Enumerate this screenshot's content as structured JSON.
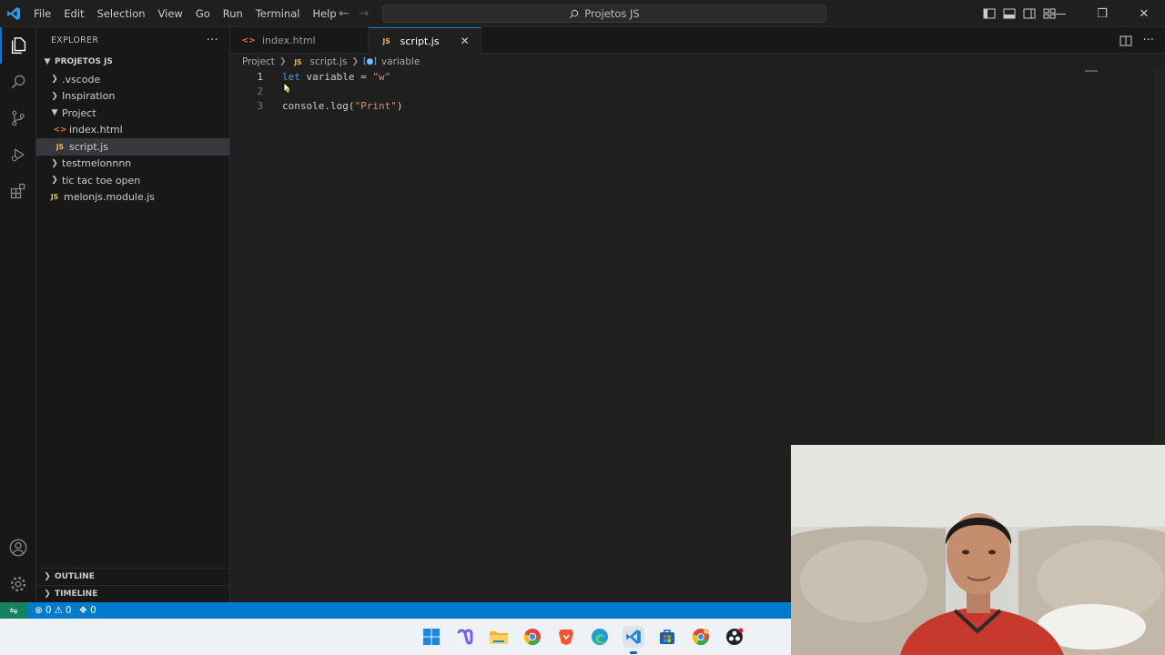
{
  "titlebar": {
    "menu": [
      "File",
      "Edit",
      "Selection",
      "View",
      "Go",
      "Run",
      "Terminal",
      "Help"
    ],
    "search": "Projetos JS"
  },
  "explorer": {
    "header": "EXPLORER",
    "workspace": "PROJETOS JS",
    "items": [
      {
        "label": ".vscode",
        "type": "folder"
      },
      {
        "label": "Inspiration",
        "type": "folder"
      },
      {
        "label": "Project",
        "type": "folder-open"
      },
      {
        "label": "index.html",
        "type": "html"
      },
      {
        "label": "script.js",
        "type": "js"
      },
      {
        "label": "testmelonnnn",
        "type": "folder"
      },
      {
        "label": "tic tac toe open",
        "type": "folder"
      },
      {
        "label": "melonjs.module.js",
        "type": "js"
      }
    ],
    "outline": "OUTLINE",
    "timeline": "TIMELINE"
  },
  "tabs": [
    {
      "label": "index.html"
    },
    {
      "label": "script.js"
    }
  ],
  "breadcrumb": {
    "folder": "Project",
    "file": "script.js",
    "symbol": "variable"
  },
  "editor": {
    "lines": [
      {
        "number": "1",
        "kw": "let",
        "rest": " variable = ",
        "str": "\"w\""
      },
      {
        "number": "2"
      },
      {
        "number": "3",
        "fn": "console.log",
        "paren": "(",
        "str": "\"Print\"",
        "close": ")"
      }
    ]
  },
  "statusbar": {
    "errors": "0",
    "warnings": "0",
    "ports": "0"
  },
  "icons": {
    "file_js": "JS",
    "file_html": "<>"
  },
  "colors": {
    "accent": "#007acc",
    "keyword": "#569cd6",
    "string": "#ce9178",
    "function": "#dcdcaa"
  }
}
